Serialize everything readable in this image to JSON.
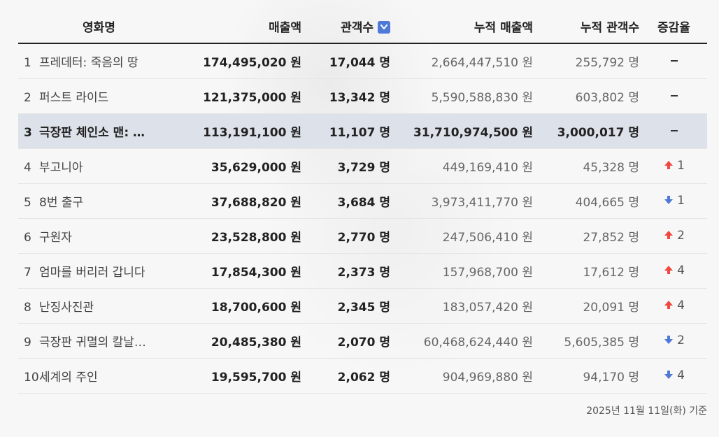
{
  "header": {
    "title": "영화명",
    "sales": "매출액",
    "audience": "관객수",
    "cum_sales": "누적 매출액",
    "cum_audience": "누적 관객수",
    "change": "증감율"
  },
  "rows": [
    {
      "rank": "1",
      "title": "프레데터: 죽음의 땅",
      "sales": "174,495,020 원",
      "audience": "17,044 명",
      "cum_sales": "2,664,447,510 원",
      "cum_audience": "255,792 명",
      "change_dir": "none",
      "change_val": ""
    },
    {
      "rank": "2",
      "title": "퍼스트 라이드",
      "sales": "121,375,000 원",
      "audience": "13,342 명",
      "cum_sales": "5,590,588,830 원",
      "cum_audience": "603,802 명",
      "change_dir": "none",
      "change_val": ""
    },
    {
      "rank": "3",
      "title": "극장판 체인소 맨: …",
      "sales": "113,191,100 원",
      "audience": "11,107 명",
      "cum_sales": "31,710,974,500 원",
      "cum_audience": "3,000,017 명",
      "change_dir": "none",
      "change_val": "",
      "highlight": true
    },
    {
      "rank": "4",
      "title": "부고니아",
      "sales": "35,629,000 원",
      "audience": "3,729 명",
      "cum_sales": "449,169,410 원",
      "cum_audience": "45,328 명",
      "change_dir": "up",
      "change_val": "1"
    },
    {
      "rank": "5",
      "title": "8번 출구",
      "sales": "37,688,820 원",
      "audience": "3,684 명",
      "cum_sales": "3,973,411,770 원",
      "cum_audience": "404,665 명",
      "change_dir": "down",
      "change_val": "1"
    },
    {
      "rank": "6",
      "title": "구원자",
      "sales": "23,528,800 원",
      "audience": "2,770 명",
      "cum_sales": "247,506,410 원",
      "cum_audience": "27,852 명",
      "change_dir": "up",
      "change_val": "2"
    },
    {
      "rank": "7",
      "title": "엄마를 버리러 갑니다",
      "sales": "17,854,300 원",
      "audience": "2,373 명",
      "cum_sales": "157,968,700 원",
      "cum_audience": "17,612 명",
      "change_dir": "up",
      "change_val": "4"
    },
    {
      "rank": "8",
      "title": "난징사진관",
      "sales": "18,700,600 원",
      "audience": "2,345 명",
      "cum_sales": "183,057,420 원",
      "cum_audience": "20,091 명",
      "change_dir": "up",
      "change_val": "4"
    },
    {
      "rank": "9",
      "title": "극장판 귀멸의 칼날…",
      "sales": "20,485,380 원",
      "audience": "2,070 명",
      "cum_sales": "60,468,624,440 원",
      "cum_audience": "5,605,385 명",
      "change_dir": "down",
      "change_val": "2"
    },
    {
      "rank": "10",
      "title": "세계의 주인",
      "sales": "19,595,700 원",
      "audience": "2,062 명",
      "cum_sales": "904,969,880 원",
      "cum_audience": "94,170 명",
      "change_dir": "down",
      "change_val": "4"
    }
  ],
  "footer": "2025년 11월 11일(화) 기준",
  "colors": {
    "up": "#f0483e",
    "down": "#4e79d6",
    "highlight": "#dde1ea",
    "sort_icon": "#4e79d6"
  },
  "icons": {
    "sort": "chevron-down-icon",
    "up": "arrow-up-icon",
    "down": "arrow-down-icon",
    "none": "dash-icon"
  }
}
